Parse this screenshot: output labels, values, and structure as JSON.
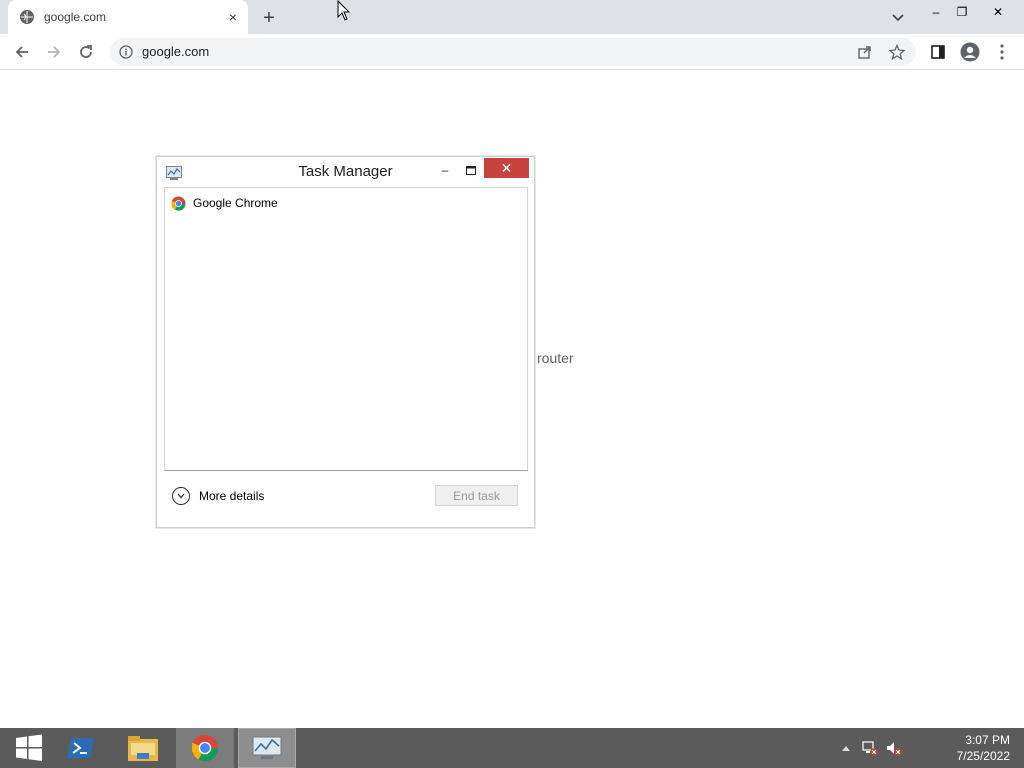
{
  "browser": {
    "tab": {
      "title": "google.com",
      "close_glyph": "×"
    },
    "new_tab_glyph": "+",
    "url": "google.com",
    "window_controls": {
      "minimize": "–",
      "restore": "❐",
      "close": "✕"
    }
  },
  "page": {
    "text": "router"
  },
  "task_manager": {
    "title": "Task Manager",
    "min_glyph": "–",
    "close_glyph": "✕",
    "processes": [
      {
        "name": "Google Chrome",
        "icon": "chrome-icon"
      }
    ],
    "more_details": "More details",
    "end_task": "End task"
  },
  "taskbar": {
    "items": [
      "windows-start",
      "powershell",
      "file-explorer",
      "google-chrome",
      "task-manager"
    ],
    "clock": {
      "time": "3:07 PM",
      "date": "7/25/2022"
    }
  },
  "colors": {
    "titlebar": "#dee1e6",
    "taskbar": "#5b5b5b",
    "close_red": "#c7443e"
  }
}
